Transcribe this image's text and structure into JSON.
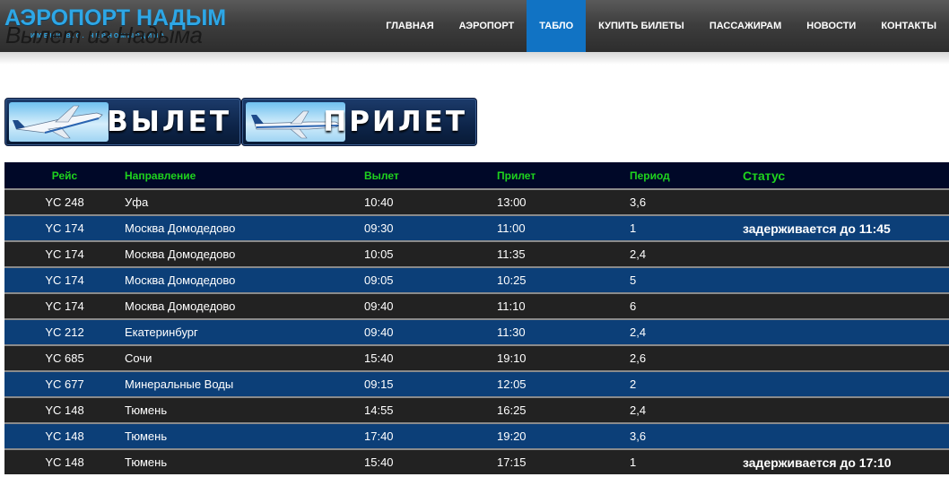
{
  "header": {
    "logo_title": "АЭРОПОРТ НАДЫМ",
    "logo_subtitle": "ИМЕНИ В.С. ЧЕРНОМЫРДИНА",
    "page_heading": "Вылет из Надыма",
    "accent_color": "#1173c4"
  },
  "nav": {
    "items": [
      {
        "label": "ГЛАВНАЯ"
      },
      {
        "label": "АЭРОПОРТ"
      },
      {
        "label": "ТАБЛО",
        "active": true
      },
      {
        "label": "КУПИТЬ БИЛЕТЫ"
      },
      {
        "label": "ПАССАЖИРАМ"
      },
      {
        "label": "НОВОСТИ"
      },
      {
        "label": "КОНТАКТЫ"
      }
    ]
  },
  "tabs": {
    "departure": "ВЫЛЕТ",
    "arrival": "ПРИЛЕТ"
  },
  "table": {
    "headers": [
      "Рейс",
      "Направление",
      "Вылет",
      "Прилет",
      "Период",
      "Статус"
    ],
    "rows": [
      [
        "YC 248",
        "Уфа",
        "10:40",
        "13:00",
        "3,6",
        ""
      ],
      [
        "YC 174",
        "Москва Домодедово",
        "09:30",
        "11:00",
        "1",
        "задерживается до 11:45"
      ],
      [
        "YC 174",
        "Москва Домодедово",
        "10:05",
        "11:35",
        "2,4",
        ""
      ],
      [
        "YC 174",
        "Москва Домодедово",
        "09:05",
        "10:25",
        "5",
        ""
      ],
      [
        "YC 174",
        "Москва Домодедово",
        "09:40",
        "11:10",
        "6",
        ""
      ],
      [
        "YC 212",
        "Екатеринбург",
        "09:40",
        "11:30",
        "2,4",
        ""
      ],
      [
        "YC 685",
        "Сочи",
        "15:40",
        "19:10",
        "2,6",
        ""
      ],
      [
        "YC 677",
        "Минеральные Воды",
        "09:15",
        "12:05",
        "2",
        ""
      ],
      [
        "YC 148",
        "Тюмень",
        "14:55",
        "16:25",
        "2,4",
        ""
      ],
      [
        "YC 148",
        "Тюмень",
        "17:40",
        "19:20",
        "3,6",
        ""
      ],
      [
        "YC 148",
        "Тюмень",
        "15:40",
        "17:15",
        "1",
        "задерживается до 17:10"
      ]
    ]
  }
}
